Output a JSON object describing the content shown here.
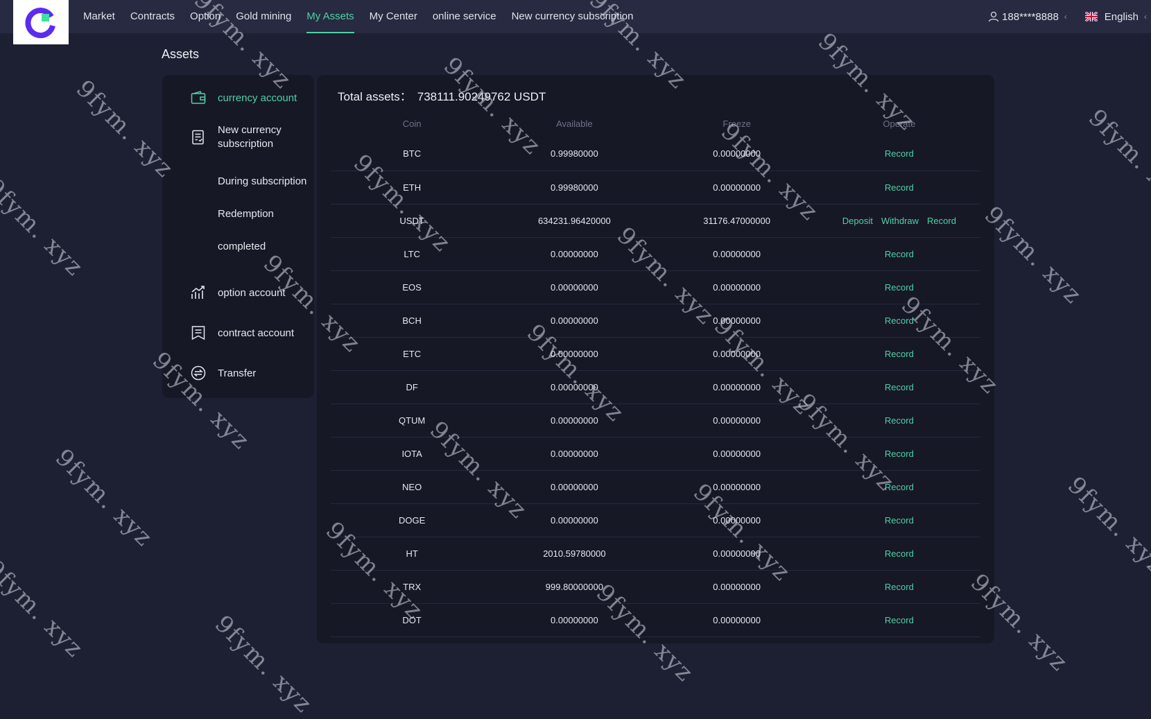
{
  "nav": {
    "items": [
      {
        "label": "Market"
      },
      {
        "label": "Contracts"
      },
      {
        "label": "Option"
      },
      {
        "label": "Gold mining"
      },
      {
        "label": "My Assets",
        "active": true
      },
      {
        "label": "My Center"
      },
      {
        "label": "online service"
      },
      {
        "label": "New currency subscription"
      }
    ],
    "user": "188****8888",
    "language": "English",
    "accent_color": "#4fd1a5"
  },
  "page": {
    "title": "Assets"
  },
  "sidebar": {
    "currency_account": "currency account",
    "new_currency_subscription": "New currency subscription",
    "during_subscription": "During subscription",
    "redemption": "Redemption",
    "completed": "completed",
    "option_account": "option account",
    "contract_account": "contract account",
    "transfer": "Transfer"
  },
  "assets": {
    "total_label": "Total assets：",
    "total_value": "738111.90249762 USDT",
    "columns": [
      "Coin",
      "Available",
      "Freeze",
      "Operate"
    ],
    "rows": [
      {
        "coin": "BTC",
        "available": "0.99980000",
        "freeze": "0.00000000",
        "ops": [
          "Record"
        ]
      },
      {
        "coin": "ETH",
        "available": "0.99980000",
        "freeze": "0.00000000",
        "ops": [
          "Record"
        ]
      },
      {
        "coin": "USDT",
        "available": "634231.96420000",
        "freeze": "31176.47000000",
        "ops": [
          "Deposit",
          "Withdraw",
          "Record"
        ]
      },
      {
        "coin": "LTC",
        "available": "0.00000000",
        "freeze": "0.00000000",
        "ops": [
          "Record"
        ]
      },
      {
        "coin": "EOS",
        "available": "0.00000000",
        "freeze": "0.00000000",
        "ops": [
          "Record"
        ]
      },
      {
        "coin": "BCH",
        "available": "0.00000000",
        "freeze": "0.00000000",
        "ops": [
          "Record"
        ]
      },
      {
        "coin": "ETC",
        "available": "0.00000000",
        "freeze": "0.00000000",
        "ops": [
          "Record"
        ]
      },
      {
        "coin": "DF",
        "available": "0.00000000",
        "freeze": "0.00000000",
        "ops": [
          "Record"
        ]
      },
      {
        "coin": "QTUM",
        "available": "0.00000000",
        "freeze": "0.00000000",
        "ops": [
          "Record"
        ]
      },
      {
        "coin": "IOTA",
        "available": "0.00000000",
        "freeze": "0.00000000",
        "ops": [
          "Record"
        ]
      },
      {
        "coin": "NEO",
        "available": "0.00000000",
        "freeze": "0.00000000",
        "ops": [
          "Record"
        ]
      },
      {
        "coin": "DOGE",
        "available": "0.00000000",
        "freeze": "0.00000000",
        "ops": [
          "Record"
        ]
      },
      {
        "coin": "HT",
        "available": "2010.59780000",
        "freeze": "0.00000000",
        "ops": [
          "Record"
        ]
      },
      {
        "coin": "TRX",
        "available": "999.80000000",
        "freeze": "0.00000000",
        "ops": [
          "Record"
        ]
      },
      {
        "coin": "DOT",
        "available": "0.00000000",
        "freeze": "0.00000000",
        "ops": [
          "Record"
        ]
      }
    ]
  },
  "watermark": {
    "text": "9fym. xyz"
  }
}
